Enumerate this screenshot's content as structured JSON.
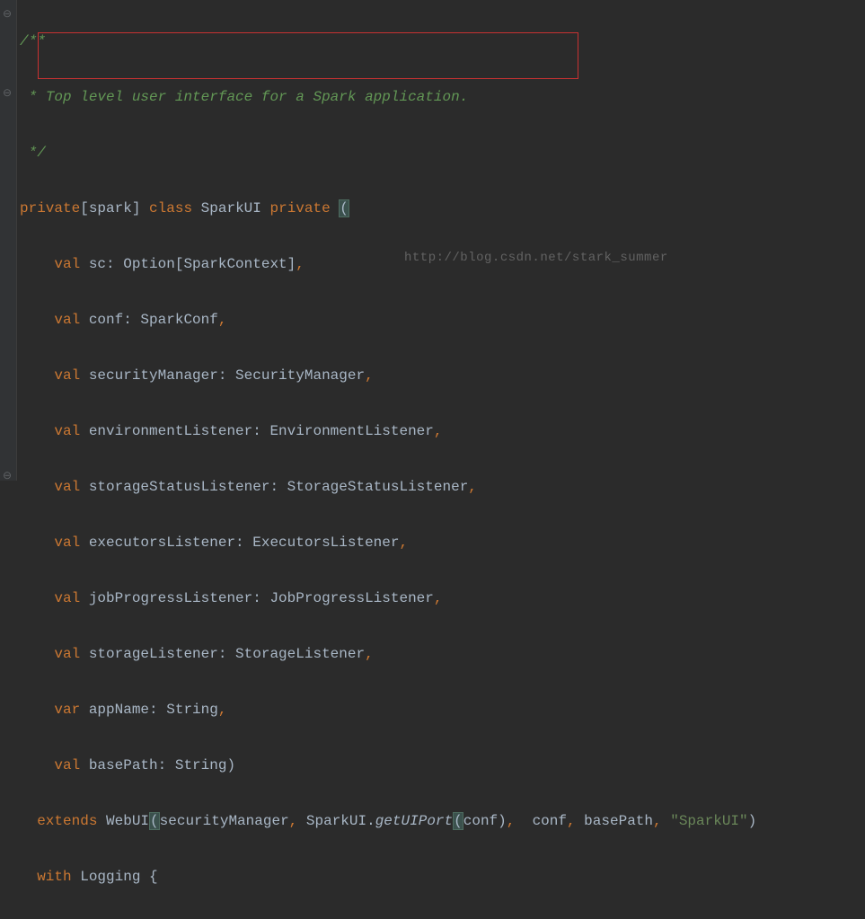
{
  "gutter": {
    "mark_top": "⊖",
    "mark_fold": "⊖",
    "mark_bottom": "⊖"
  },
  "watermark": "http://blog.csdn.net/stark_summer",
  "code": {
    "l1_open": "/**",
    "l2_star": " *",
    "l2_text": "Top level user interface for a Spark application.",
    "l3_close": " */",
    "l4_private": "private",
    "l4_brk_open": "[",
    "l4_spark": "spark",
    "l4_brk_close": "] ",
    "l4_class": "class",
    "l4_clsname": " SparkUI ",
    "l4_private2": "private ",
    "l4_paren": "(",
    "l5_pad": "    ",
    "l5_val": "val",
    "l5_name": " sc: Option[SparkContext]",
    "l5_c": ",",
    "l6_val": "val",
    "l6_name": " conf: SparkConf",
    "l6_c": ",",
    "l7_val": "val",
    "l7_name": " securityManager: SecurityManager",
    "l7_c": ",",
    "l8_val": "val",
    "l8_name": " environmentListener: EnvironmentListener",
    "l8_c": ",",
    "l9_val": "val",
    "l9_name": " storageStatusListener: StorageStatusListener",
    "l9_c": ",",
    "l10_val": "val",
    "l10_name": " executorsListener: ExecutorsListener",
    "l10_c": ",",
    "l11_val": "val",
    "l11_name": " jobProgressListener: JobProgressListener",
    "l11_c": ",",
    "l12_val": "val",
    "l12_name": " storageListener: StorageListener",
    "l12_c": ",",
    "l13_var": "var",
    "l13_name": " appName: ",
    "l13_type": "String",
    "l13_c": ",",
    "l14_val": "val",
    "l14_name": " basePath: ",
    "l14_type": "String",
    "l14_paren": ")",
    "l15_pad": "  ",
    "l15_extends": "extends",
    "l15_webui": " WebUI",
    "l15_p1": "(",
    "l15_args1": "securityManager",
    "l15_c1": ",",
    "l15_sparkui": " SparkUI.",
    "l15_getui": "getUIPort",
    "l15_p2": "(",
    "l15_conf": "conf)",
    "l15_c2": ",",
    "l15_rest": "  conf",
    "l15_c3": ",",
    "l15_bp": " basePath",
    "l15_c4": ",",
    "l15_sp": " ",
    "l15_str": "\"SparkUI\"",
    "l15_close": ")",
    "l16_pad": "  ",
    "l16_with": "with",
    "l16_log": " Logging {"
  }
}
